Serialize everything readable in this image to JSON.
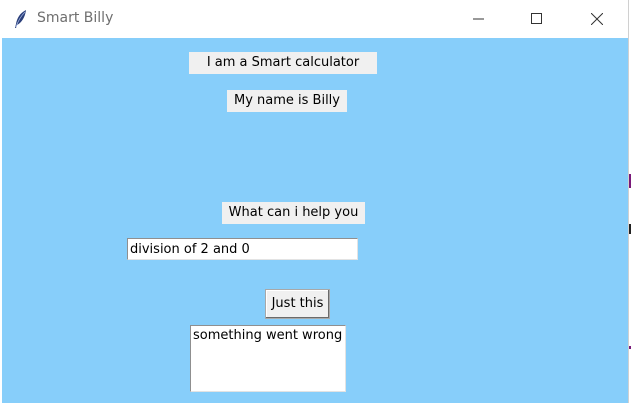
{
  "window": {
    "title": "Smart Billy",
    "icon": "feather-icon",
    "controls": [
      "minimize-icon",
      "maximize-icon",
      "close-icon"
    ]
  },
  "labels": {
    "intro": "I am a Smart calculator",
    "name": "My name is Billy",
    "prompt": "What can i help you"
  },
  "query_input": {
    "value": "division of 2 and 0"
  },
  "submit_button": {
    "label": "Just this"
  },
  "output_box": {
    "value": "something went wrong"
  },
  "colors": {
    "background": "#87cefa",
    "label_background": "#f0f0f0"
  }
}
